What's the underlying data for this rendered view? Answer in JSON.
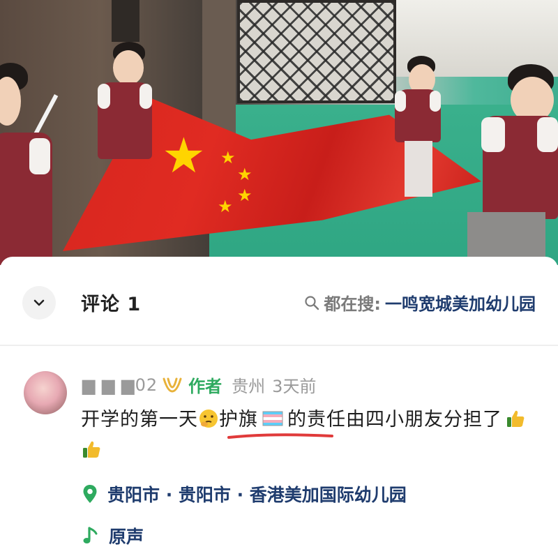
{
  "comments_panel": {
    "title": "评论 1",
    "search_prefix": "都在搜:",
    "search_term": "一鸣宽城美加幼儿园"
  },
  "comment": {
    "username": "▆ ▆ ▆02",
    "author_badge": "作者",
    "location": "贵州",
    "time": "3天前",
    "text_part1": "开学的第一天",
    "text_part2": "护旗",
    "text_part3": "的责任由四小朋友分担了",
    "accent_color": "#2eaa5f",
    "underline_color": "#e03a3a"
  },
  "poi": {
    "label": "贵阳市 · 贵阳市 · 香港美加国际幼儿园"
  },
  "sound": {
    "label": "原声"
  },
  "icons": [
    "chevron-down-icon",
    "search-icon",
    "user-badge-icon",
    "hmm-emoji",
    "trans-flag-emoji",
    "thumbs-up-icon",
    "map-pin-icon",
    "music-note-icon"
  ]
}
